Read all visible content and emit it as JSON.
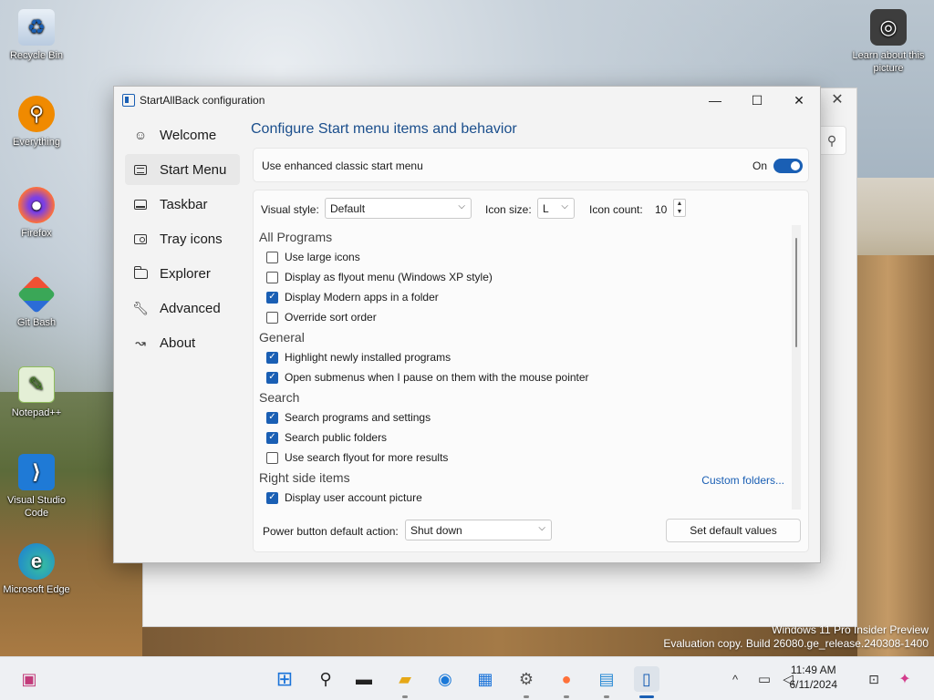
{
  "desktop": {
    "icons": [
      {
        "label": "Recycle Bin",
        "icon": "recycle-bin-icon"
      },
      {
        "label": "Everything",
        "icon": "everything-search-icon"
      },
      {
        "label": "Firefox",
        "icon": "firefox-icon"
      },
      {
        "label": "Git Bash",
        "icon": "git-bash-icon"
      },
      {
        "label": "Notepad++",
        "icon": "notepad-plus-plus-icon"
      },
      {
        "label": "Visual Studio Code",
        "icon": "vscode-icon"
      },
      {
        "label": "Microsoft Edge",
        "icon": "edge-icon"
      }
    ],
    "learn": {
      "label": "Learn about this picture",
      "icon": "camera-icon"
    },
    "watermark": {
      "line1": "Windows 11 Pro Insider Preview",
      "line2": "Evaluation copy. Build 26080.ge_release.240308-1400"
    }
  },
  "window": {
    "title": "StartAllBack configuration",
    "controls": {
      "minimize": "—",
      "maximize": "☐",
      "close": "✕"
    },
    "nav": [
      {
        "label": "Welcome",
        "icon": "smiley-icon",
        "active": false
      },
      {
        "label": "Start Menu",
        "icon": "start-menu-icon",
        "active": true
      },
      {
        "label": "Taskbar",
        "icon": "taskbar-icon",
        "active": false
      },
      {
        "label": "Tray icons",
        "icon": "tray-icon",
        "active": false
      },
      {
        "label": "Explorer",
        "icon": "folder-icon",
        "active": false
      },
      {
        "label": "Advanced",
        "icon": "wrench-icon",
        "active": false
      },
      {
        "label": "About",
        "icon": "about-icon",
        "active": false
      }
    ],
    "heading": "Configure Start menu items and behavior",
    "enhanced": {
      "label": "Use enhanced classic start menu",
      "state": "On",
      "on": true
    },
    "visual_style": {
      "label": "Visual style:",
      "value": "Default"
    },
    "icon_size": {
      "label": "Icon size:",
      "value": "L"
    },
    "icon_count": {
      "label": "Icon count:",
      "value": "10"
    },
    "sections": {
      "all_programs": {
        "title": "All Programs",
        "options": [
          {
            "label": "Use large icons",
            "checked": false
          },
          {
            "label": "Display as flyout menu (Windows XP style)",
            "checked": false
          },
          {
            "label": "Display Modern apps in a folder",
            "checked": true
          },
          {
            "label": "Override sort order",
            "checked": false
          }
        ]
      },
      "general": {
        "title": "General",
        "options": [
          {
            "label": "Highlight newly installed programs",
            "checked": true
          },
          {
            "label": "Open submenus when I pause on them with the mouse pointer",
            "checked": true
          }
        ]
      },
      "search": {
        "title": "Search",
        "options": [
          {
            "label": "Search programs and settings",
            "checked": true
          },
          {
            "label": "Search public folders",
            "checked": true
          },
          {
            "label": "Use search flyout for more results",
            "checked": false
          }
        ]
      },
      "right_side": {
        "title": "Right side items",
        "link": "Custom folders...",
        "options": [
          {
            "label": "Display user account picture",
            "checked": true
          }
        ]
      }
    },
    "power": {
      "label": "Power button default action:",
      "value": "Shut down"
    },
    "default_button": "Set default values"
  },
  "taskbar": {
    "clock_time": "11:49 AM",
    "clock_date": "6/11/2024",
    "chevron": "^",
    "colors": {
      "accent": "#1a5fb4"
    }
  }
}
